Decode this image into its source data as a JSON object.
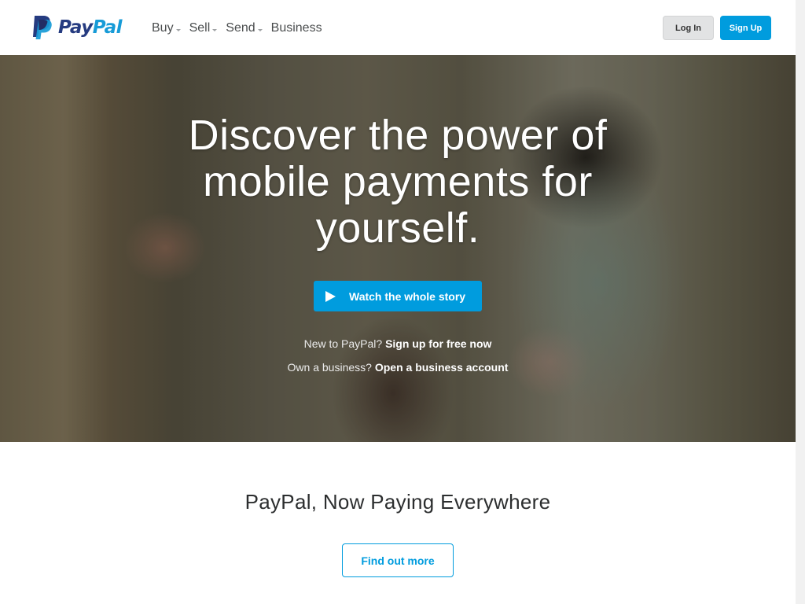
{
  "header": {
    "logo": {
      "part1": "Pay",
      "part2": "Pal"
    },
    "nav": [
      {
        "label": "Buy",
        "has_dropdown": true
      },
      {
        "label": "Sell",
        "has_dropdown": true
      },
      {
        "label": "Send",
        "has_dropdown": true
      },
      {
        "label": "Business",
        "has_dropdown": false
      }
    ],
    "login_label": "Log In",
    "signup_label": "Sign Up"
  },
  "hero": {
    "title_lines": [
      "Discover the power of",
      "mobile payments for",
      "yourself."
    ],
    "watch_label": "Watch the whole story",
    "new_prefix": "New to PayPal?",
    "new_link": "Sign up for free now",
    "business_prefix": "Own a business?",
    "business_link": "Open a business account"
  },
  "promo": {
    "title": "PayPal, Now Paying Everywhere",
    "button_label": "Find out more"
  },
  "colors": {
    "brand_dark_blue": "#253b80",
    "brand_light_blue": "#179bd7",
    "accent": "#009cde",
    "nav_text": "#4a4d4e"
  },
  "icons": {
    "logo": "paypal-p-icon",
    "dropdown": "chevron-down-icon",
    "play": "play-icon"
  }
}
